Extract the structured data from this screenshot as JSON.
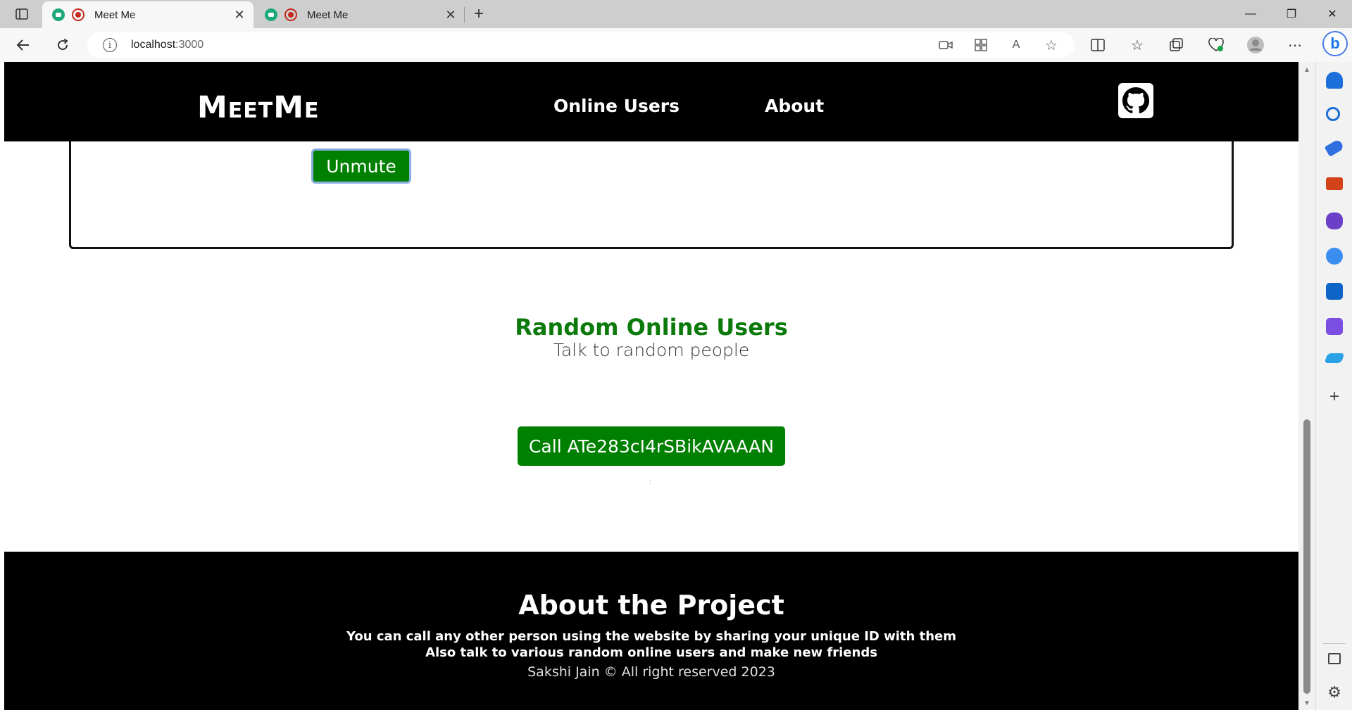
{
  "browser": {
    "tabs": [
      {
        "title": "Meet Me",
        "active": true,
        "close_glyph": "✕"
      },
      {
        "title": "Meet Me",
        "active": false,
        "close_glyph": "✕"
      }
    ],
    "new_tab_glyph": "+",
    "window_controls": {
      "minimize": "—",
      "maximize": "❐",
      "close": "✕"
    },
    "address": {
      "host": "localhost",
      "port": ":3000",
      "info_glyph": "i"
    },
    "sidebar_icons": [
      "bell-icon",
      "search-icon",
      "tag-icon",
      "toolbox-icon",
      "games-icon",
      "m365-icon",
      "outlook-icon",
      "designer-icon",
      "send-icon",
      "add-icon",
      "split-panel-icon",
      "settings-icon"
    ]
  },
  "site": {
    "logo": "MeetMe",
    "nav": {
      "online_users": "Online Users",
      "about": "About"
    },
    "unmute_label": "Unmute",
    "random_section": {
      "title": "Random Online Users",
      "subtitle": "Talk to random people",
      "call_button": "Call ATe283cI4rSBikAVAAAN",
      "tiny_mark": ":"
    },
    "footer": {
      "title": "About the Project",
      "line1": "You can call any other person using the website by sharing your unique ID with them",
      "line2": "Also talk to various random online users and make new friends",
      "copyright": "Sakshi Jain © All right reserved 2023"
    }
  },
  "colors": {
    "brand_green": "#008000",
    "title_green": "#0b7a0b",
    "nav_bg": "#000000"
  }
}
